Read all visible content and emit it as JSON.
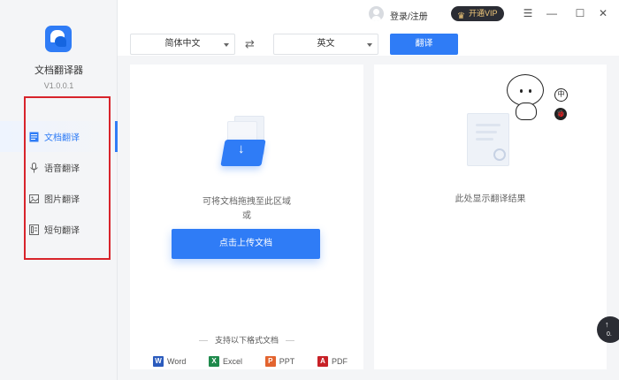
{
  "app": {
    "name": "文档翻译器",
    "version": "V1.0.0.1"
  },
  "sidebar": {
    "items": [
      {
        "label": "文档翻译",
        "icon": "document-icon",
        "active": true
      },
      {
        "label": "语音翻译",
        "icon": "microphone-icon",
        "active": false
      },
      {
        "label": "图片翻译",
        "icon": "image-icon",
        "active": false
      },
      {
        "label": "短句翻译",
        "icon": "sentence-icon",
        "active": false
      }
    ]
  },
  "topbar": {
    "login": "登录/注册",
    "vip": "开通VIP",
    "window_buttons": {
      "menu": "☰",
      "minimize": "—",
      "maximize": "☐",
      "close": "✕"
    }
  },
  "translate_bar": {
    "source_lang": "简体中文",
    "swap_icon": "⇄",
    "target_lang": "英文",
    "translate_label": "翻译"
  },
  "upload": {
    "drop_hint": "可将文档拖拽至此区域",
    "or": "或",
    "button_label": "点击上传文档",
    "formats_title": "支持以下格式文档",
    "formats": [
      {
        "label": "Word",
        "badge": "W",
        "color": "#2b5bbd"
      },
      {
        "label": "Excel",
        "badge": "X",
        "color": "#1f8a4c"
      },
      {
        "label": "PPT",
        "badge": "P",
        "color": "#e3642f"
      },
      {
        "label": "PDF",
        "badge": "A",
        "color": "#c82127"
      }
    ]
  },
  "result": {
    "placeholder": "此处显示翻译结果",
    "mascot_sign_1": "中",
    "mascot_sign_2": "🐞"
  },
  "float": {
    "arrow": "↑",
    "value": "0."
  },
  "colors": {
    "accent": "#2f7cf6",
    "highlight_box": "#d8242b"
  }
}
